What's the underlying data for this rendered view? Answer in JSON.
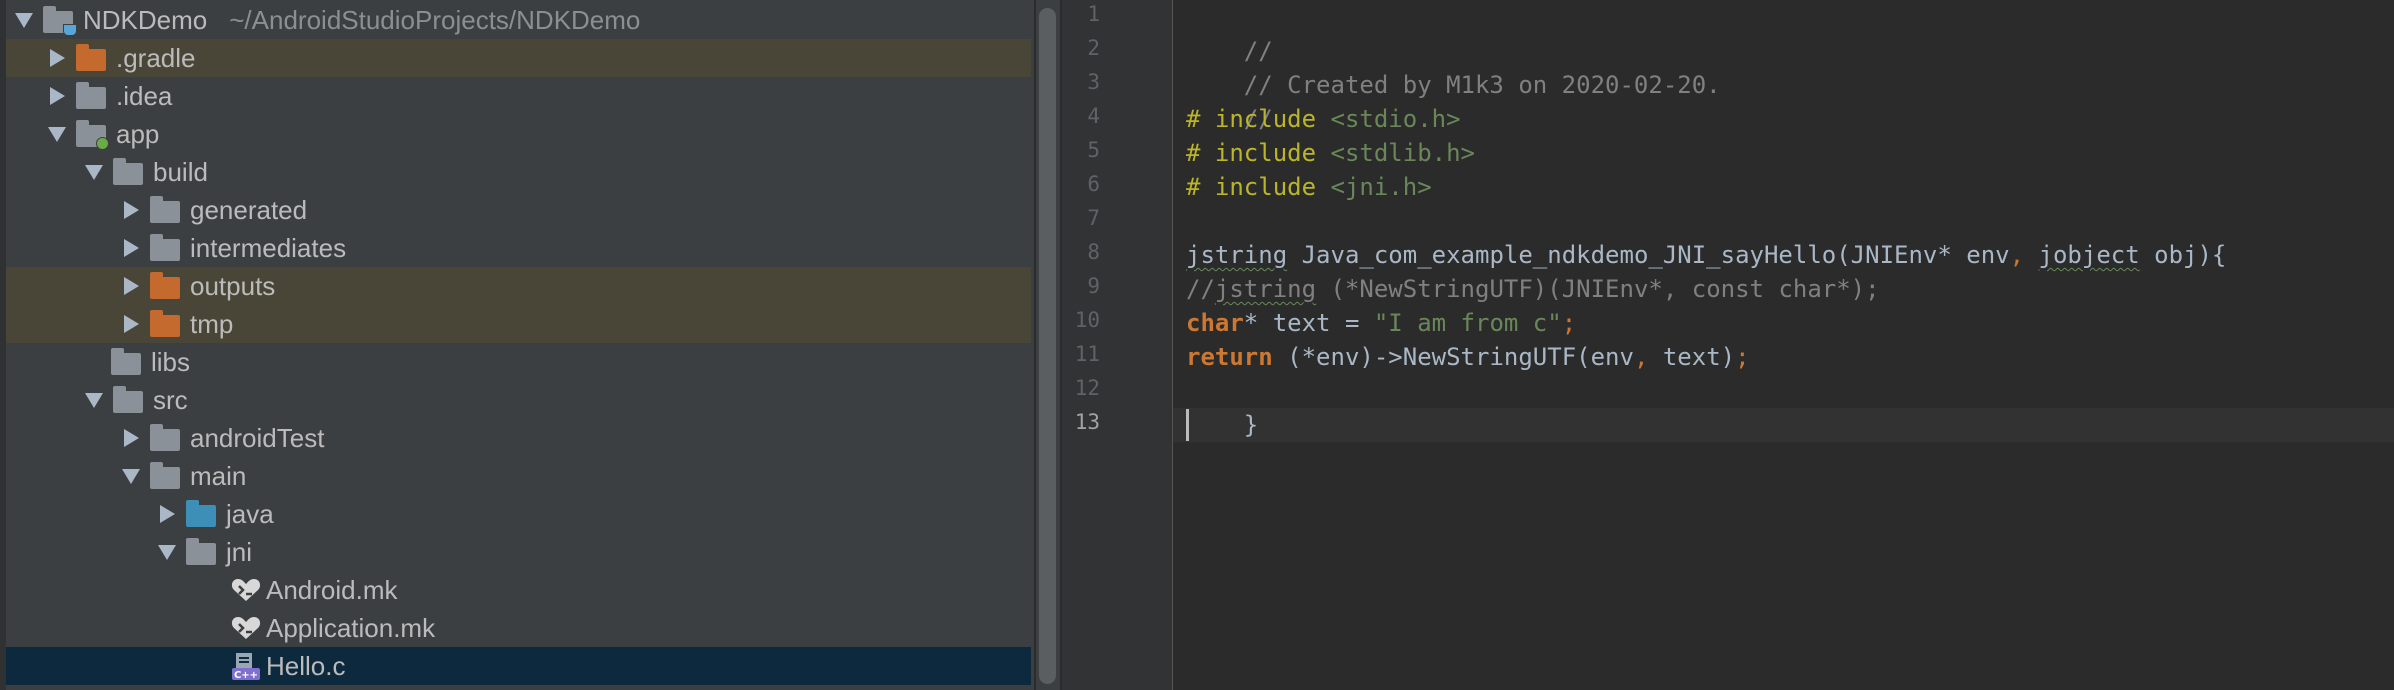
{
  "project_tree": {
    "root": {
      "name": "NDKDemo",
      "path": "~/AndroidStudioProjects/NDKDemo"
    },
    "items": [
      {
        "label": ".gradle"
      },
      {
        "label": ".idea"
      },
      {
        "label": "app"
      },
      {
        "label": "build"
      },
      {
        "label": "generated"
      },
      {
        "label": "intermediates"
      },
      {
        "label": "outputs"
      },
      {
        "label": "tmp"
      },
      {
        "label": "libs"
      },
      {
        "label": "src"
      },
      {
        "label": "androidTest"
      },
      {
        "label": "main"
      },
      {
        "label": "java"
      },
      {
        "label": "jni"
      },
      {
        "label": "Android.mk"
      },
      {
        "label": "Application.mk"
      },
      {
        "label": "Hello.c"
      }
    ],
    "selected": "Hello.c"
  },
  "editor": {
    "file": "Hello.c",
    "current_line": 13,
    "line_numbers": [
      "1",
      "2",
      "3",
      "4",
      "5",
      "6",
      "7",
      "8",
      "9",
      "10",
      "11",
      "12",
      "13"
    ],
    "lines": {
      "l1": "//",
      "l2": "// Created by M1k3 on 2020-02-20.",
      "l3": "//",
      "l4_pp": "# include",
      "l4_inc": " <stdio.h>",
      "l5_pp": "# include",
      "l5_inc": " <stdlib.h>",
      "l6_pp": "# include",
      "l6_inc": " <jni.h>",
      "l8_a": "jstring",
      "l8_b": " Java_com_example_ndkdemo_JNI_sayHello(JNIEnv* env",
      "l8_c": ",",
      "l8_d": " ",
      "l8_e": "jobject",
      "l8_f": " obj){",
      "l9_a": "//",
      "l9_b": "jstring",
      "l9_c": " (*NewStringUTF)(JNIEnv*, const char*);",
      "l10_kw": "char",
      "l10_a": "* text = ",
      "l10_str": "\"I am from c\"",
      "l10_sep": ";",
      "l11_kw": "return",
      "l11_a": " (*env)->NewStringUTF(env",
      "l11_sep1": ",",
      "l11_b": " text)",
      "l11_sep2": ";",
      "l12": "}"
    }
  },
  "colors": {
    "tree_bg": "#3c3f41",
    "editor_bg": "#2b2b2b",
    "selection": "#0d293e",
    "excluded_row": "#4a4637",
    "keyword": "#cc7832",
    "string": "#6a8759",
    "comment": "#808080",
    "preprocessor": "#bbb529"
  }
}
